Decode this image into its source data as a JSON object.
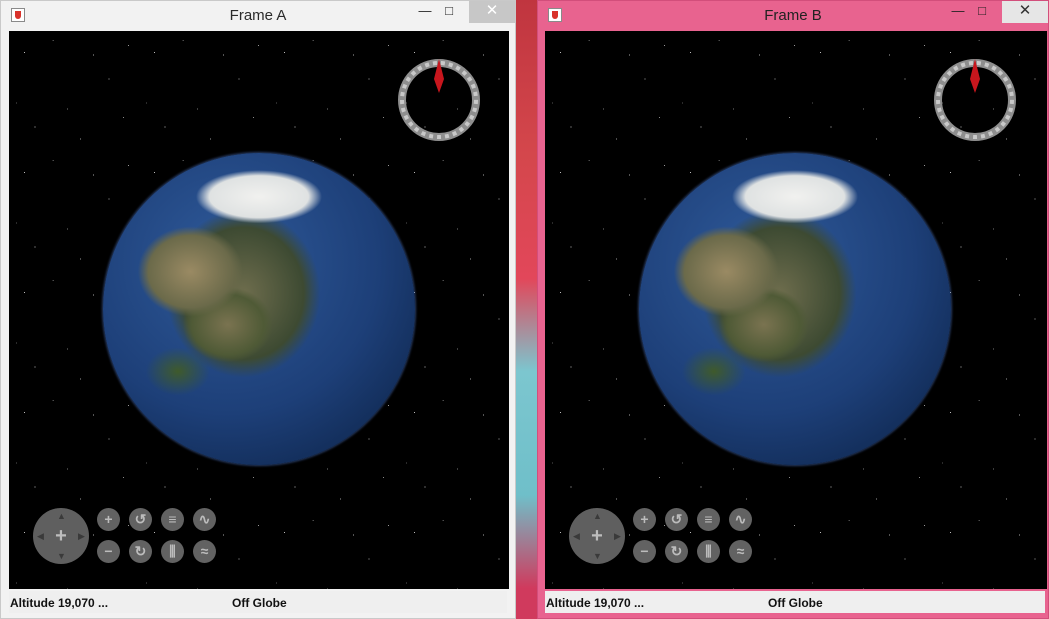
{
  "background": {
    "accent": "#7cc6cf"
  },
  "windows": [
    {
      "title": "Frame A",
      "controls": {
        "minimize": "—",
        "maximize": "□",
        "close": "✕"
      },
      "status": {
        "altitude": "Altitude  19,070 ...",
        "position": "Off Globe"
      }
    },
    {
      "title": "Frame B",
      "controls": {
        "minimize": "—",
        "maximize": "□",
        "close": "✕"
      },
      "status": {
        "altitude": "Altitude  19,070 ...",
        "position": "Off Globe"
      },
      "border_color": "#e8638f"
    }
  ],
  "nav_buttons": {
    "row1": [
      "zoom-in",
      "rotate-left",
      "tilt-up",
      "elevation-up"
    ],
    "row2": [
      "zoom-out",
      "rotate-right",
      "tilt-down",
      "elevation-down"
    ]
  },
  "icons": {
    "zoom_in": "+",
    "zoom_out": "−",
    "rotate_left": "↺",
    "rotate_right": "↻",
    "tilt_up": "≡",
    "tilt_down": "⫼",
    "elevation_up": "∿",
    "elevation_down": "≈",
    "pan_center": "+"
  }
}
